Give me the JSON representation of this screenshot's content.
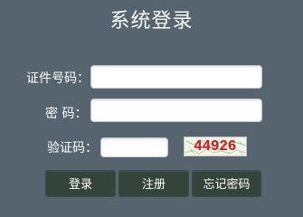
{
  "title": "系统登录",
  "form": {
    "id_label": "证件号码：",
    "id_value": "",
    "password_label": "密  码：",
    "password_value": "",
    "captcha_label": "验证码：",
    "captcha_value": "",
    "captcha_image_text": "44926"
  },
  "buttons": {
    "login": "登录",
    "register": "注册",
    "forgot": "忘记密码"
  },
  "colors": {
    "background": "#56646f",
    "button": "#35443b",
    "captcha_text": "#c81e1e"
  }
}
